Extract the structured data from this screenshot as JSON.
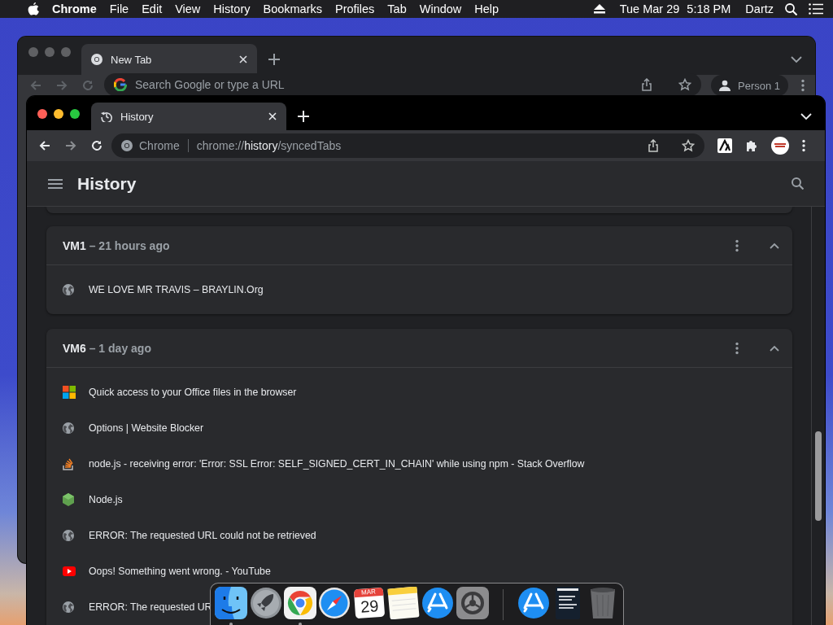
{
  "menubar": {
    "app": "Chrome",
    "menus": [
      "File",
      "Edit",
      "View",
      "History",
      "Bookmarks",
      "Profiles",
      "Tab",
      "Window",
      "Help"
    ],
    "date": "Tue Mar 29",
    "time": "5:18 PM",
    "user": "Dartz"
  },
  "back_window": {
    "tab": {
      "title": "New Tab"
    },
    "omnibox": {
      "placeholder": "Search Google or type a URL"
    },
    "profile": "Person 1"
  },
  "front_window": {
    "tab": {
      "title": "History"
    },
    "omnibox": {
      "chip": "Chrome",
      "url_scheme": "chrome://",
      "url_host": "history",
      "url_path": "/syncedTabs"
    },
    "page_title": "History",
    "devices": [
      {
        "name": "VM1",
        "time": "– 21 hours ago",
        "expanded": true,
        "tabs": [
          {
            "title": "WE LOVE MR TRAVIS – BRAYLIN.Org",
            "kind": "globe"
          }
        ]
      },
      {
        "name": "VM6",
        "time": "– 1 day ago",
        "expanded": true,
        "tabs": [
          {
            "title": "Quick access to your Office files in the browser",
            "kind": "windows"
          },
          {
            "title": "Options | Website Blocker",
            "kind": "globe"
          },
          {
            "title": "node.js - receiving error: 'Error: SSL Error: SELF_SIGNED_CERT_IN_CHAIN' while using npm - Stack Overflow",
            "kind": "stack"
          },
          {
            "title": "Node.js",
            "kind": "hexagon"
          },
          {
            "title": "ERROR: The requested URL could not be retrieved",
            "kind": "globe"
          },
          {
            "title": "Oops! Something went wrong. - YouTube",
            "kind": "play"
          },
          {
            "title": "ERROR: The requested UR",
            "kind": "globe"
          }
        ]
      }
    ]
  },
  "dock": {
    "items": [
      {
        "kind": "finder",
        "running": true
      },
      {
        "kind": "rocket",
        "running": false
      },
      {
        "kind": "browser",
        "running": true
      },
      {
        "kind": "compass",
        "running": false
      },
      {
        "kind": "calendar",
        "month": "MAR",
        "day": "29",
        "running": false
      },
      {
        "kind": "notes",
        "running": false
      },
      {
        "kind": "store",
        "running": false
      },
      {
        "kind": "gear",
        "running": false
      },
      {
        "kind": "separator"
      },
      {
        "kind": "store",
        "running": false
      },
      {
        "kind": "book",
        "running": false
      },
      {
        "kind": "trash",
        "running": false
      }
    ]
  }
}
